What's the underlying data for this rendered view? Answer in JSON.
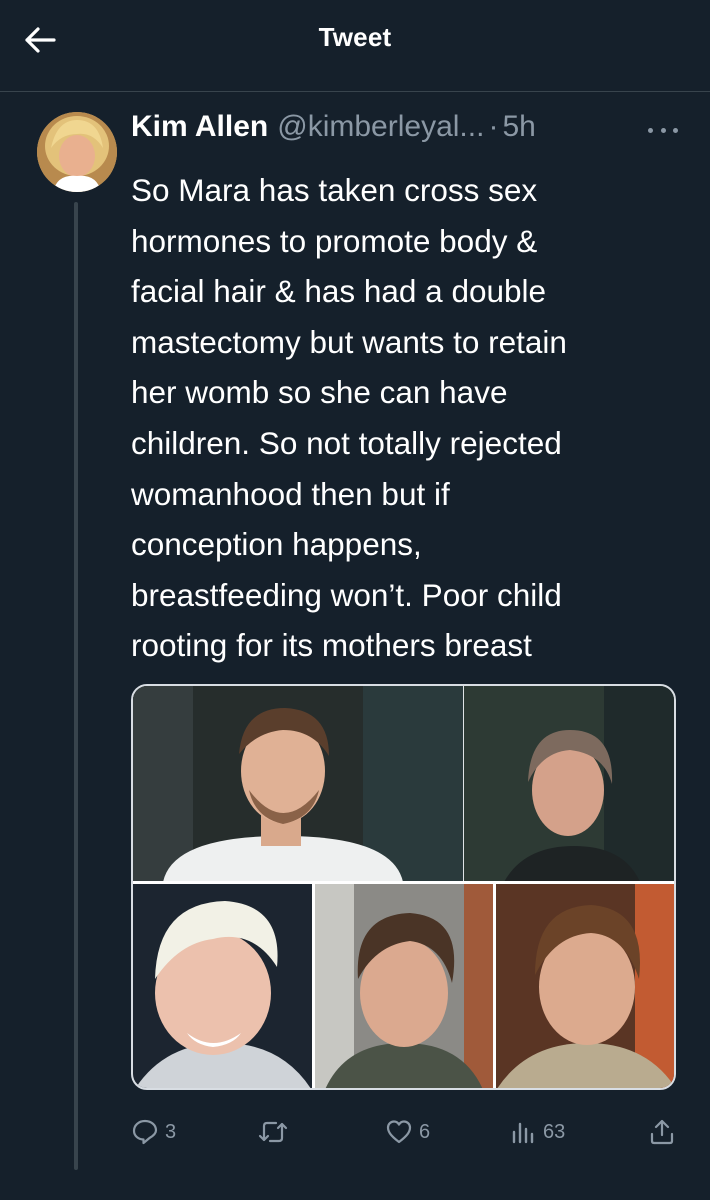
{
  "header": {
    "title": "Tweet",
    "back_icon": "arrow-left-icon"
  },
  "tweet": {
    "author_name": "Kim Allen",
    "handle": "@kimberleyal...",
    "separator": "·",
    "time": "5h",
    "text_lines": [
      "So Mara has taken cross sex",
      "hormones to promote body &",
      "facial hair & has had a double",
      "mastectomy but wants to retain",
      "her womb so she can have",
      "children. So not totally rejected",
      "womanhood then but if",
      "conception happens,",
      "breastfeeding won’t. Poor child",
      "rooting for its mothers breast"
    ]
  },
  "actions": {
    "reply_count": "3",
    "retweet_count": "",
    "like_count": "6",
    "views_count": "63",
    "icons": [
      "reply-icon",
      "retweet-icon",
      "like-icon",
      "views-icon",
      "share-icon"
    ]
  },
  "colors": {
    "background": "#15202b",
    "secondary_text": "#8b98a5",
    "divider": "#38444d",
    "accent": "#1d9bf0"
  }
}
